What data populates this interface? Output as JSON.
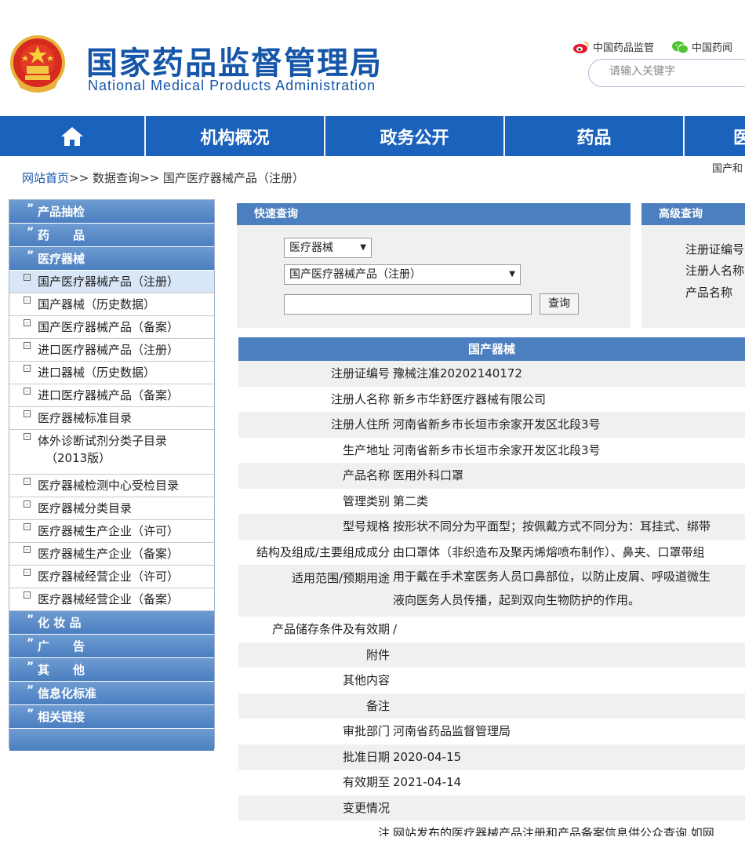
{
  "header": {
    "title_cn": "国家药品监督管理局",
    "title_en": "National Medical Products Administration",
    "weibo_label": "中国药品监管",
    "wechat_label": "中国药闻",
    "search_placeholder": "请输入关键字"
  },
  "nav": {
    "items": [
      "机构概况",
      "政务公开",
      "药品",
      "医"
    ]
  },
  "breadcrumb": {
    "home": "网站首页",
    "sep": ">>",
    "level2": "数据查询",
    "level3": "国产医疗器械产品（注册）",
    "right_cut": "国产和"
  },
  "sidebar": {
    "heads": {
      "h1": "产品抽检",
      "h2": "药　　品",
      "h3": "医疗器械",
      "h4": "化 妆 品",
      "h5": "广　　告",
      "h6": "其　　他",
      "h7": "信息化标准",
      "h8": "相关链接"
    },
    "items": [
      "国产医疗器械产品（注册）",
      "国产器械（历史数据）",
      "国产医疗器械产品（备案）",
      "进口医疗器械产品（注册）",
      "进口器械（历史数据）",
      "进口医疗器械产品（备案）",
      "医疗器械标准目录",
      "体外诊断试剂分类子目录",
      "（2013版）",
      "医疗器械检测中心受检目录",
      "医疗器械分类目录",
      "医疗器械生产企业（许可）",
      "医疗器械生产企业（备案）",
      "医疗器械经营企业（许可）",
      "医疗器械经营企业（备案）"
    ]
  },
  "quick": {
    "title": "快速查询",
    "select_type": "医疗器械",
    "select_sub": "国产医疗器械产品（注册）",
    "input_value": "",
    "button": "查询"
  },
  "advanced": {
    "title": "高级查询",
    "labels": [
      "注册证编号",
      "注册人名称",
      "产品名称"
    ]
  },
  "detail": {
    "title": "国产器械",
    "rows": [
      {
        "k": "注册证编号",
        "v": "豫械注准20202140172"
      },
      {
        "k": "注册人名称",
        "v": "新乡市华舒医疗器械有限公司"
      },
      {
        "k": "注册人住所",
        "v": "河南省新乡市长垣市余家开发区北段3号"
      },
      {
        "k": "生产地址",
        "v": "河南省新乡市长垣市余家开发区北段3号"
      },
      {
        "k": "产品名称",
        "v": "医用外科口罩"
      },
      {
        "k": "管理类别",
        "v": "第二类"
      },
      {
        "k": "型号规格",
        "v": "按形状不同分为平面型；按佩戴方式不同分为：耳挂式、绑带"
      },
      {
        "k": "结构及组成/主要组成成分",
        "v": "由口罩体（非织造布及聚丙烯熔喷布制作）、鼻夹、口罩带组"
      },
      {
        "k": "适用范围/预期用途",
        "v": "用于戴在手术室医务人员口鼻部位，以防止皮屑、呼吸道微生",
        "v2": "液向医务人员传播，起到双向生物防护的作用。"
      },
      {
        "k": "产品储存条件及有效期",
        "v": "/"
      },
      {
        "k": "附件",
        "v": ""
      },
      {
        "k": "其他内容",
        "v": ""
      },
      {
        "k": "备注",
        "v": ""
      },
      {
        "k": "审批部门",
        "v": "河南省药品监督管理局"
      },
      {
        "k": "批准日期",
        "v": "2020-04-15"
      },
      {
        "k": "有效期至",
        "v": "2021-04-14"
      },
      {
        "k": "变更情况",
        "v": ""
      },
      {
        "k": "注",
        "v": "网站发布的医疗器械产品注册和产品备案信息供公众查询,如网"
      }
    ]
  },
  "colors": {
    "brand_blue": "#1656a9",
    "nav_blue": "#1b62bc",
    "panel_blue": "#4b7fc0"
  }
}
